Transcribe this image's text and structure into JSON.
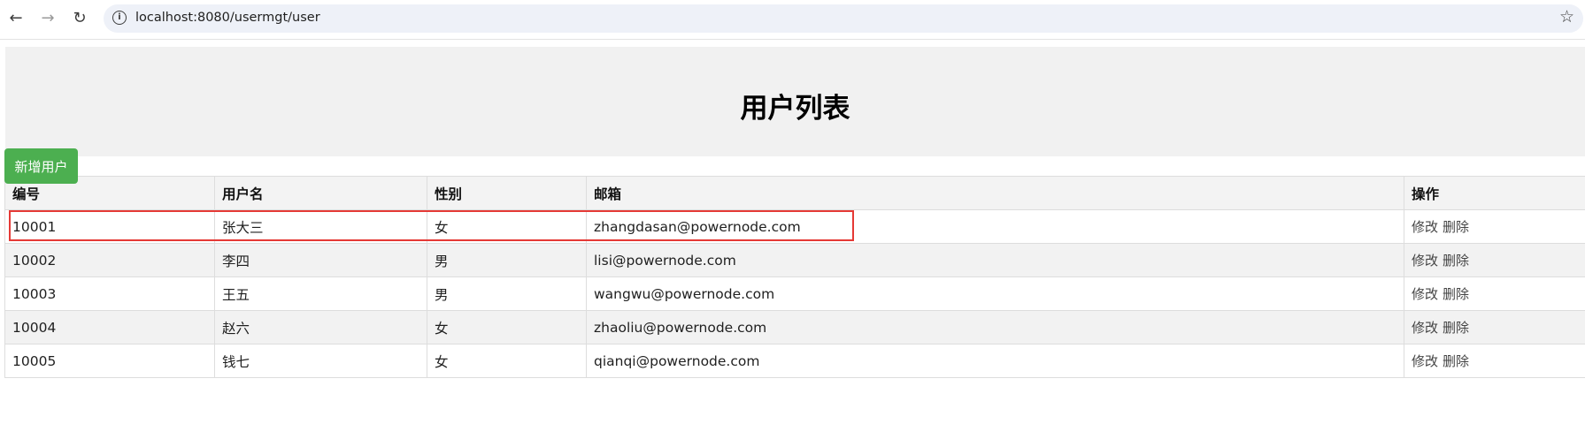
{
  "browser": {
    "url": "localhost:8080/usermgt/user",
    "back_icon": "←",
    "forward_icon": "→",
    "reload_icon": "↻",
    "info_icon": "i",
    "bookmark_icon": "☆"
  },
  "page": {
    "title": "用户列表",
    "add_button": "新增用户"
  },
  "table": {
    "headers": {
      "id": "编号",
      "username": "用户名",
      "gender": "性别",
      "email": "邮箱",
      "actions": "操作"
    },
    "rows": [
      {
        "id": "10001",
        "username": "张大三",
        "gender": "女",
        "email": "zhangdasan@powernode.com",
        "edit": "修改",
        "delete": "删除"
      },
      {
        "id": "10002",
        "username": "李四",
        "gender": "男",
        "email": "lisi@powernode.com",
        "edit": "修改",
        "delete": "删除"
      },
      {
        "id": "10003",
        "username": "王五",
        "gender": "男",
        "email": "wangwu@powernode.com",
        "edit": "修改",
        "delete": "删除"
      },
      {
        "id": "10004",
        "username": "赵六",
        "gender": "女",
        "email": "zhaoliu@powernode.com",
        "edit": "修改",
        "delete": "删除"
      },
      {
        "id": "10005",
        "username": "钱七",
        "gender": "女",
        "email": "qianqi@powernode.com",
        "edit": "修改",
        "delete": "删除"
      }
    ]
  },
  "colors": {
    "add_button": "#4caf50",
    "highlight_border": "#e53935",
    "header_band": "#f1f1f1"
  }
}
